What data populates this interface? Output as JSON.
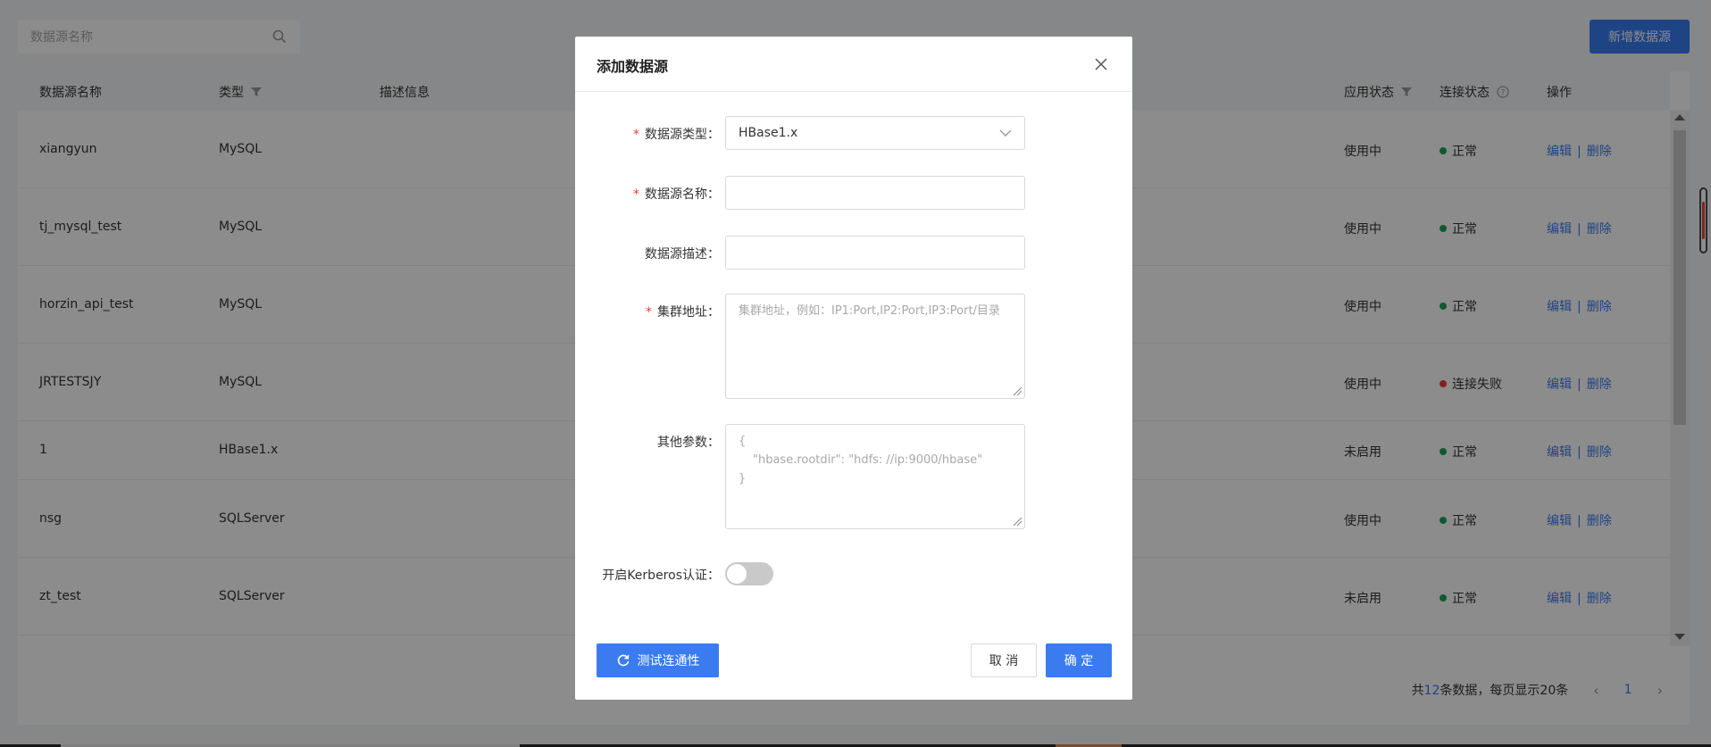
{
  "search": {
    "placeholder": "数据源名称"
  },
  "add_button": "新增数据源",
  "table": {
    "headers": {
      "name": "数据源名称",
      "type": "类型",
      "desc": "描述信息",
      "app_status": "应用状态",
      "conn_status": "连接状态",
      "ops": "操作"
    },
    "rows": [
      {
        "name": "xiangyun",
        "type": "MySQL",
        "app_status": "使用中",
        "conn_status": "正常",
        "conn_color": "#1aa35b"
      },
      {
        "name": "tj_mysql_test",
        "type": "MySQL",
        "app_status": "使用中",
        "conn_status": "正常",
        "conn_color": "#1aa35b"
      },
      {
        "name": "horzin_api_test",
        "type": "MySQL",
        "app_status": "使用中",
        "conn_status": "正常",
        "conn_color": "#1aa35b"
      },
      {
        "name": "JRTESTSJY",
        "type": "MySQL",
        "app_status": "使用中",
        "conn_status": "连接失败",
        "conn_color": "#e8413a"
      },
      {
        "name": "1",
        "type": "HBase1.x",
        "app_status": "未启用",
        "conn_status": "正常",
        "conn_color": "#1aa35b"
      },
      {
        "name": "nsg",
        "type": "SQLServer",
        "app_status": "使用中",
        "conn_status": "正常",
        "conn_color": "#1aa35b"
      },
      {
        "name": "zt_test",
        "type": "SQLServer",
        "app_status": "未启用",
        "conn_status": "正常",
        "conn_color": "#1aa35b"
      }
    ],
    "edit_label": "编辑",
    "delete_label": "删除",
    "op_separator": "|"
  },
  "pager": {
    "total_prefix": "共",
    "total": "12",
    "total_suffix": "条数据，每页显示20条",
    "prev": "‹",
    "current": "1",
    "next": "›"
  },
  "modal": {
    "title": "添加数据源",
    "fields": {
      "type": {
        "label": "数据源类型：",
        "required": "*",
        "value": "HBase1.x"
      },
      "name": {
        "label": "数据源名称：",
        "required": "*",
        "value": ""
      },
      "desc": {
        "label": "数据源描述：",
        "value": ""
      },
      "cluster": {
        "label": "集群地址：",
        "required": "*",
        "placeholder": "集群地址，例如：IP1:Port,IP2:Port,IP3:Port/目录"
      },
      "params": {
        "label": "其他参数：",
        "line1": "{",
        "line2": "\"hbase.rootdir\": \"hdfs: //ip:9000/hbase\"",
        "line3": "}"
      },
      "kerberos": {
        "label": "开启Kerberos认证：",
        "enabled": false
      }
    },
    "test_button": "测试连通性",
    "cancel_button": "取 消",
    "ok_button": "确 定"
  },
  "colors": {
    "accent": "#3a7cf0",
    "ok": "#1aa35b",
    "fail": "#e8413a"
  }
}
